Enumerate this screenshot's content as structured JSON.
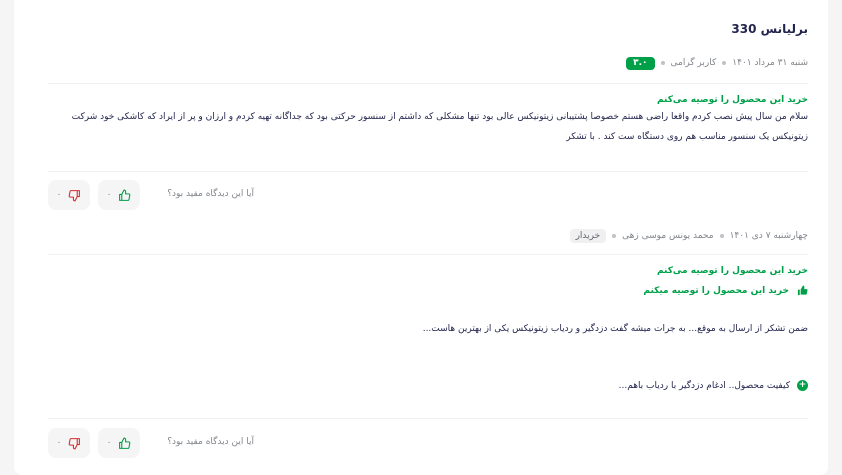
{
  "product": {
    "title": "برلیانس 330"
  },
  "reviews": [
    {
      "date": "شنبه ۳۱ مرداد ۱۴۰۱",
      "author": "کاربر گرامی",
      "score": "۳.۰",
      "recommend": "خرید این محصول را توصیه می‌کنم",
      "text": "سلام من سال پیش نصب کردم واقعا راضی هستم خصوصا پشتیبانی زیتونیکس عالی بود تنها مشکلی که داشتم از سنسور حرکتی بود که جداگانه تهیه کردم و ارزان و پر از ایراد که کاشکی خود شرکت زیتونیکس یک سنسور مناسب هم روی دستگاه ست کند . با تشکر",
      "helpful_question": "آیا این دیدگاه مفید بود؟",
      "likes": "۰",
      "dislikes": "۰"
    },
    {
      "date": "چهارشنبه ۷ دی ۱۴۰۱",
      "author": "محمد یونس موسی زهی",
      "badge": "خریدار",
      "recommend": "خرید این محصول را توصیه می‌کنم",
      "recommend_line": "خرید این محصول را توصیه میکنم",
      "text": "ضمن تشکر از ارسال به موقع... به جرات میشه گفت دزدگیر و ردیاب زیتونیکس یکی از بهترین هاست...",
      "pro": "کیفیت محصول.. ادغام دزدگیر با ردیاب باهم...",
      "helpful_question": "آیا این دیدگاه مفید بود؟",
      "likes": "۰",
      "dislikes": "۰"
    }
  ],
  "colors": {
    "accent_green": "#00a049",
    "accent_red": "#d32f2f"
  }
}
